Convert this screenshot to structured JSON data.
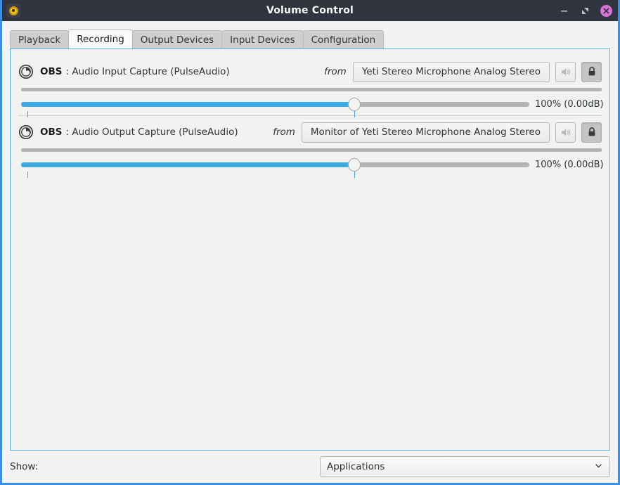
{
  "window": {
    "title": "Volume Control",
    "app_icon": "volume-icon",
    "buttons": {
      "minimize": "minimize-icon",
      "maximize": "maximize-icon",
      "close": "close-icon"
    },
    "accent_color": "#3a8ee6",
    "titlebar_color": "#2f343f",
    "close_button_color": "#d673d6"
  },
  "tabs": [
    {
      "label": "Playback",
      "active": false
    },
    {
      "label": "Recording",
      "active": true
    },
    {
      "label": "Output Devices",
      "active": false
    },
    {
      "label": "Input Devices",
      "active": false
    },
    {
      "label": "Configuration",
      "active": false
    }
  ],
  "streams": [
    {
      "icon": "obs-icon",
      "app": "OBS",
      "description": ": Audio Input Capture (PulseAudio)",
      "from_label": "from",
      "device": "Yeti Stereo Microphone Analog Stereo",
      "mute_button": "speaker-icon",
      "lock_button": "lock-icon",
      "lock_pressed": true,
      "volume_percent": 100,
      "volume_label": "100% (0.00dB)",
      "slider_position_percent": 65.5,
      "fill_color": "#3eaae4"
    },
    {
      "icon": "obs-icon",
      "app": "OBS",
      "description": ": Audio Output Capture (PulseAudio)",
      "from_label": "from",
      "device": "Monitor of Yeti Stereo Microphone Analog Stereo",
      "mute_button": "speaker-icon",
      "lock_button": "lock-icon",
      "lock_pressed": true,
      "volume_percent": 100,
      "volume_label": "100% (0.00dB)",
      "slider_position_percent": 65.5,
      "fill_color": "#3eaae4"
    }
  ],
  "footer": {
    "show_label": "Show:",
    "show_value": "Applications",
    "chevron": "chevron-down-icon"
  }
}
